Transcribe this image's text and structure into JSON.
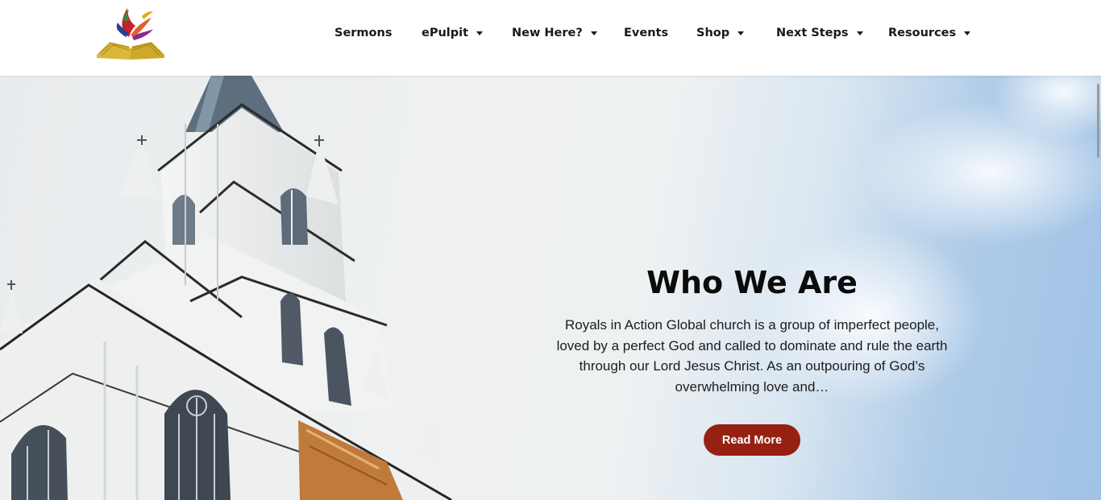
{
  "header": {
    "logo_icon": "church-logo-bird-open-book-icon",
    "nav": [
      {
        "label": "Sermons",
        "has_dropdown": false
      },
      {
        "label": "ePulpit",
        "has_dropdown": true
      },
      {
        "label": "New Here?",
        "has_dropdown": true
      },
      {
        "label": "Events",
        "has_dropdown": false
      },
      {
        "label": "Shop",
        "has_dropdown": true
      },
      {
        "label": "Next Steps",
        "has_dropdown": true
      },
      {
        "label": "Resources",
        "has_dropdown": true
      }
    ]
  },
  "hero": {
    "background_image": "white-church-steeple-against-sky",
    "title": "Who We Are",
    "description": "Royals in Action Global church is a group of imperfect people, loved by a perfect God and called to dominate and rule the earth through our Lord Jesus Christ. As an outpouring of God’s overwhelming love and…",
    "button_label": "Read More"
  },
  "colors": {
    "button_bg": "#962113",
    "text_dark": "#0b0b0b",
    "sky_blue": "#9fc2e6",
    "logo_gold": "#d9b83a",
    "logo_red": "#c8202a"
  }
}
